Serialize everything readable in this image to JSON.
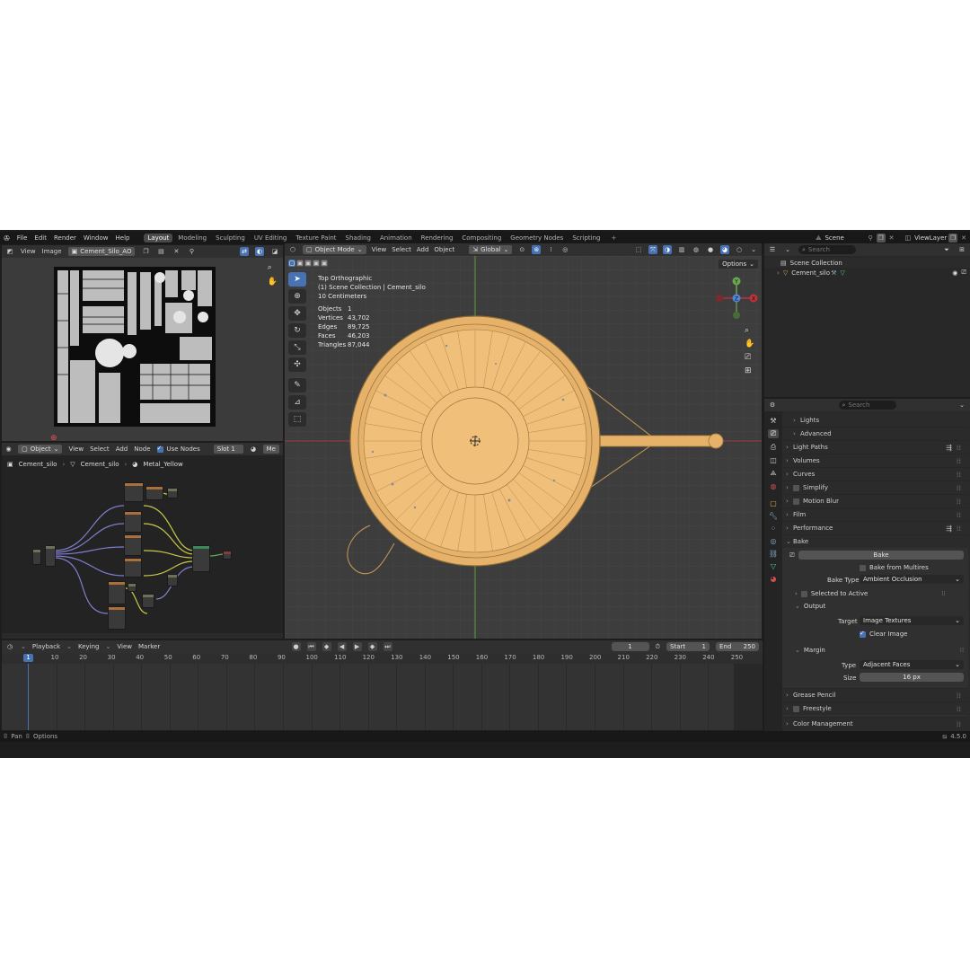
{
  "topbar": {
    "menus": [
      "File",
      "Edit",
      "Render",
      "Window",
      "Help"
    ],
    "workspaces": [
      "Layout",
      "Modeling",
      "Sculpting",
      "UV Editing",
      "Texture Paint",
      "Shading",
      "Animation",
      "Rendering",
      "Compositing",
      "Geometry Nodes",
      "Scripting"
    ],
    "active_workspace": "Layout",
    "scene": "Scene",
    "view_layer": "ViewLayer"
  },
  "image_editor": {
    "menus": [
      "View",
      "Image"
    ],
    "image_name": "Cement_Silo_AO"
  },
  "viewport": {
    "mode": "Object Mode",
    "menus": [
      "View",
      "Select",
      "Add",
      "Object"
    ],
    "transform": "Global",
    "options": "Options",
    "view_name": "Top Orthographic",
    "collection_info": "(1) Scene Collection | Cement_silo",
    "scale": "10 Centimeters",
    "stats": [
      {
        "label": "Objects",
        "value": "1"
      },
      {
        "label": "Vertices",
        "value": "43,702"
      },
      {
        "label": "Edges",
        "value": "89,725"
      },
      {
        "label": "Faces",
        "value": "46,203"
      },
      {
        "label": "Triangles",
        "value": "87,044"
      }
    ],
    "gizmo": {
      "y": "Y",
      "x": "X",
      "z": "Z"
    }
  },
  "node_editor": {
    "mode": "Object",
    "menus": [
      "View",
      "Select",
      "Add",
      "Node"
    ],
    "use_nodes": "Use Nodes",
    "slot": "Slot 1",
    "material_short": "Me",
    "breadcrumb": [
      "Cement_silo",
      "Cement_silo",
      "Metal_Yellow"
    ]
  },
  "outliner": {
    "search_placeholder": "Search",
    "scene_collection": "Scene Collection",
    "object": "Cement_silo"
  },
  "properties": {
    "search_placeholder": "Search",
    "sections": {
      "lights": "Lights",
      "advanced": "Advanced",
      "light_paths": "Light Paths",
      "volumes": "Volumes",
      "curves": "Curves",
      "simplify": "Simplify",
      "motion_blur": "Motion Blur",
      "film": "Film",
      "performance": "Performance",
      "bake": "Bake",
      "grease_pencil": "Grease Pencil",
      "freestyle": "Freestyle",
      "color_management": "Color Management"
    },
    "bake_button": "Bake",
    "bake_from_multires": "Bake from Multires",
    "bake_type_label": "Bake Type",
    "bake_type_value": "Ambient Occlusion",
    "selected_to_active": "Selected to Active",
    "output": "Output",
    "target_label": "Target",
    "target_value": "Image Textures",
    "clear_image": "Clear Image",
    "margin": "Margin",
    "type_label": "Type",
    "type_value": "Adjacent Faces",
    "size_label": "Size",
    "size_value": "16 px"
  },
  "timeline": {
    "menus": [
      "Playback",
      "Keying",
      "View",
      "Marker"
    ],
    "current_frame": "1",
    "start_label": "Start",
    "start_value": "1",
    "end_label": "End",
    "end_value": "250",
    "ticks": [
      "10",
      "20",
      "30",
      "40",
      "50",
      "60",
      "70",
      "80",
      "90",
      "100",
      "110",
      "120",
      "130",
      "140",
      "150",
      "160",
      "170",
      "180",
      "190",
      "200",
      "210",
      "220",
      "230",
      "240",
      "250"
    ],
    "playhead": "1"
  },
  "statusbar": {
    "pan": "Pan",
    "options": "Options",
    "version": "4.5.0"
  },
  "colors": {
    "accent": "#4772b3",
    "header": "#303030",
    "background": "#1d1d1d",
    "mesh": "#e6b26a",
    "x_axis": "#c0313a",
    "y_axis": "#6aa84f",
    "z_axis": "#4f86d6"
  }
}
